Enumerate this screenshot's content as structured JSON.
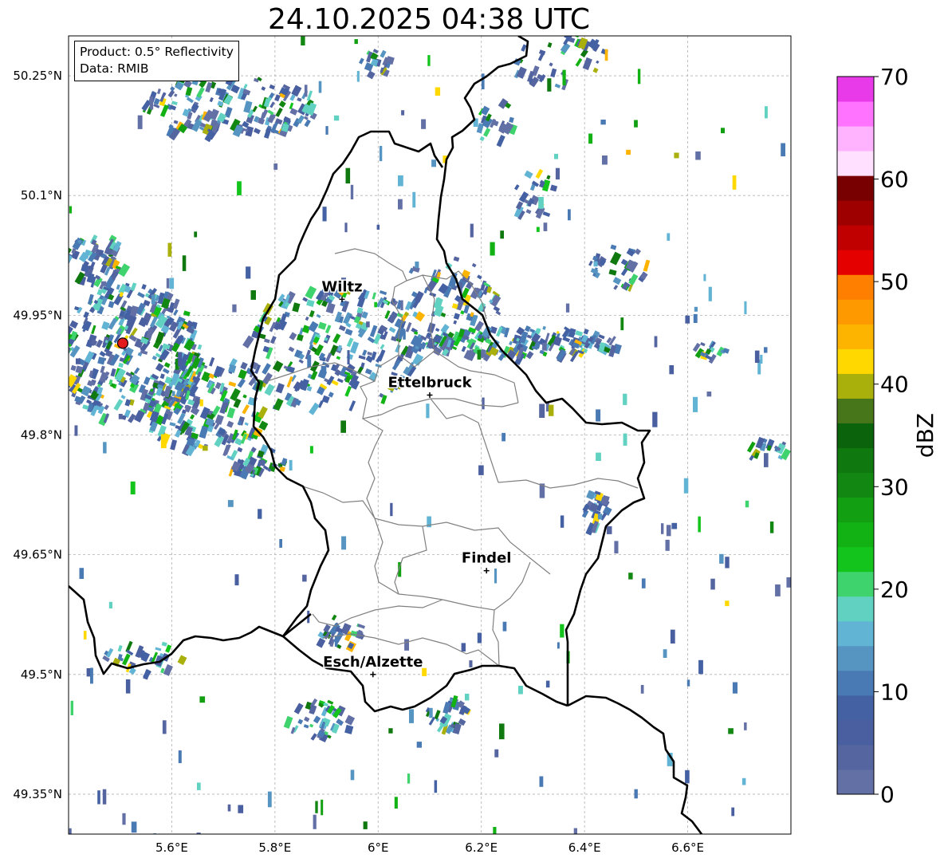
{
  "title": "24.10.2025 04:38 UTC",
  "info_box": {
    "product": "Product: 0.5° Reflectivity",
    "data_source": "Data: RMIB"
  },
  "map": {
    "lon_range": [
      5.4,
      6.8
    ],
    "lat_range": [
      49.3,
      50.3
    ],
    "lon_ticks": [
      {
        "value": 5.6,
        "label": "5.6°E"
      },
      {
        "value": 5.8,
        "label": "5.8°E"
      },
      {
        "value": 6.0,
        "label": "6°E"
      },
      {
        "value": 6.2,
        "label": "6.2°E"
      },
      {
        "value": 6.4,
        "label": "6.4°E"
      },
      {
        "value": 6.6,
        "label": "6.6°E"
      }
    ],
    "lat_ticks": [
      {
        "value": 50.25,
        "label": "50.25°N"
      },
      {
        "value": 50.1,
        "label": "50.1°N"
      },
      {
        "value": 49.95,
        "label": "49.95°N"
      },
      {
        "value": 49.8,
        "label": "49.8°N"
      },
      {
        "value": 49.65,
        "label": "49.65°N"
      },
      {
        "value": 49.5,
        "label": "49.5°N"
      },
      {
        "value": 49.35,
        "label": "49.35°N"
      }
    ],
    "grid": true,
    "cities": [
      {
        "name": "Wiltz",
        "lon": 5.93,
        "lat": 49.97
      },
      {
        "name": "Ettelbruck",
        "lon": 6.1,
        "lat": 49.85
      },
      {
        "name": "Findel",
        "lon": 6.21,
        "lat": 49.63
      },
      {
        "name": "Esch/Alzette",
        "lon": 5.99,
        "lat": 49.5
      }
    ],
    "radar_site": {
      "lon": 5.505,
      "lat": 49.915,
      "color": "#e31a1c"
    }
  },
  "colorbar": {
    "label": "dBZ",
    "min": 0,
    "max": 70,
    "ticks": [
      0,
      10,
      20,
      30,
      40,
      50,
      60,
      70
    ],
    "colors": [
      "#6370a6",
      "#5565a0",
      "#4a5f9f",
      "#4461a3",
      "#4a7ab3",
      "#5695c2",
      "#62b4d4",
      "#61d2c2",
      "#3ed36c",
      "#13c41c",
      "#12b214",
      "#12a012",
      "#128712",
      "#0f790f",
      "#0b630b",
      "#477519",
      "#aab00b",
      "#ffd800",
      "#fdb400",
      "#ff9900",
      "#ff7f00",
      "#e50000",
      "#c00000",
      "#9e0000",
      "#780000",
      "#ffe1ff",
      "#ffb3ff",
      "#ff73ff",
      "#e93ae9"
    ]
  }
}
